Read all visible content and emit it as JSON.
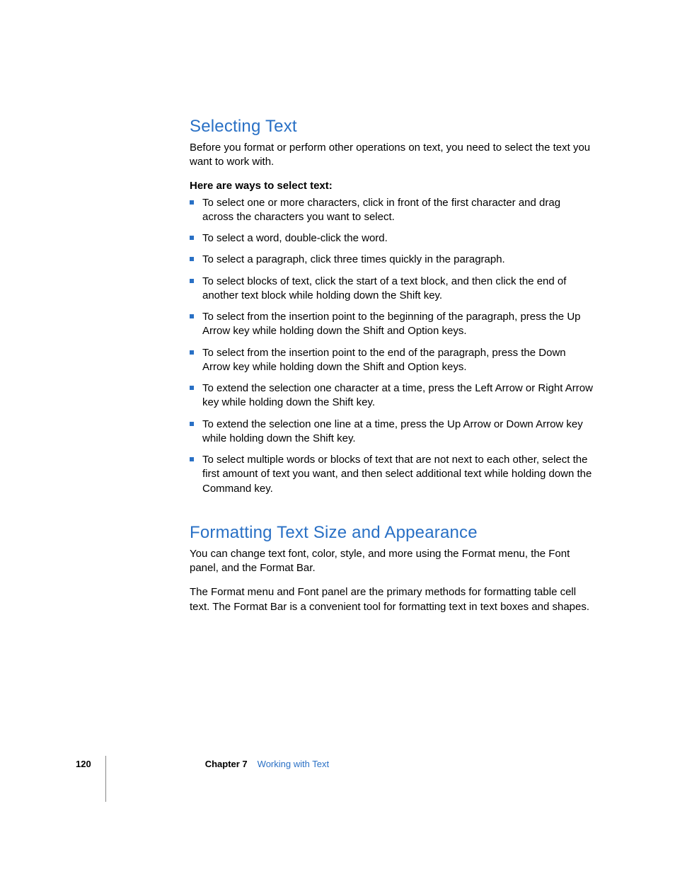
{
  "section1": {
    "heading": "Selecting Text",
    "intro": "Before you format or perform other operations on text, you need to select the text you want to work with.",
    "subhead": "Here are ways to select text:",
    "bullets": [
      "To select one or more characters, click in front of the first character and drag across the characters you want to select.",
      "To select a word, double-click the word.",
      "To select a paragraph, click three times quickly in the paragraph.",
      "To select blocks of text, click the start of a text block, and then click the end of another text block while holding down the Shift key.",
      "To select from the insertion point to the beginning of the paragraph, press the Up Arrow key while holding down the Shift and Option keys.",
      "To select from the insertion point to the end of the paragraph, press the Down Arrow key while holding down the Shift and Option keys.",
      "To extend the selection one character at a time, press the Left Arrow or Right Arrow key while holding down the Shift key.",
      "To extend the selection one line at a time, press the Up Arrow or Down Arrow key while holding down the Shift key.",
      "To select multiple words or blocks of text that are not next to each other, select the first amount of text you want, and then select additional text while holding down the Command key."
    ]
  },
  "section2": {
    "heading": "Formatting Text Size and Appearance",
    "para1": "You can change text font, color, style, and more using the Format menu, the Font panel, and the Format Bar.",
    "para2": "The Format menu and Font panel are the primary methods for formatting table cell text. The Format Bar is a convenient tool for formatting text in text boxes and shapes."
  },
  "footer": {
    "page": "120",
    "chapter_label": "Chapter 7",
    "chapter_title": "Working with Text"
  }
}
